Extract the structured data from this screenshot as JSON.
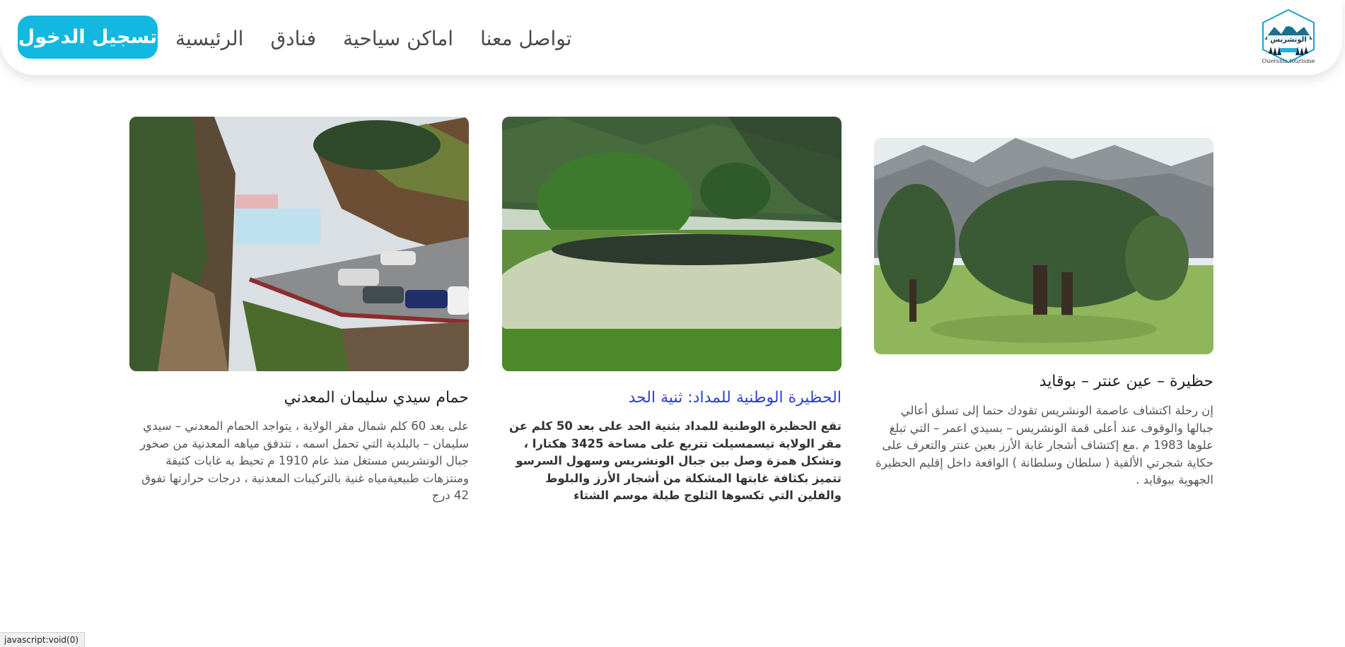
{
  "nav": {
    "login_label": "تسجيل الدخول",
    "links": [
      "الرئيسية",
      "فنادق",
      "اماكن سياحية",
      "تواصل معنا"
    ],
    "logo_caption": "Ouersnis tourisme",
    "logo_title": "الونشريس"
  },
  "cards": [
    {
      "title": "حمام سيدي سليمان المعدني",
      "text": "على بعد 60 كلم شمال مقر الولاية ، يتواجد الحمام المعدني – سيدي سليمان – بالبلدية التي تحمل اسمه ، تتدفق مياهه المعدنية من صخور جبال الونشريس مستغل منذ عام 1910 م تحيط به غابات كثيفة ومنتزهات طبيعيةمياه غنية بالتركيبات المعدنية ، درجات حرارتها تفوق 42 درج"
    },
    {
      "title": "الحظيرة الوطنية للمداد: ثنية الحد",
      "text": "تقع الحظيرة الوطنية للمداد بثنية الحد على بعد 50 كلم عن مقر الولاية تيسمسيلت تتربع على مساحة 3425 هكتارا ، وتشكل همزة وصل بين جبال الونشريس وسهول السرسو تتميز بكثافة غابتها المشكلة من أشجار الأرز والبلوط والفلين التي تكسوها الثلوج طيلة موسم الشتاء"
    },
    {
      "title": "حظيرة – عين عنتر – بوقايد",
      "text": "إن رحلة اكتشاف عاصمة الونشريس تقودك حتما إلى تسلق أعالي جبالها والوقوف عند أعلى قمة الونشريس – بسيدي اعمر – التي تبلغ علوها 1983 م .مع إكتشاف أشجار غابة الأرز بعين عنتر والتعرف على حكاية شجرتي الألفية ( سلطان وسلطانة ) الواقعة داخل إقليم الحظيرة الجهوية ببوقايد ."
    }
  ],
  "status_bar": "javascript:void(0)",
  "colors": {
    "accent": "#12b8e0",
    "link": "#2f3fd8"
  }
}
